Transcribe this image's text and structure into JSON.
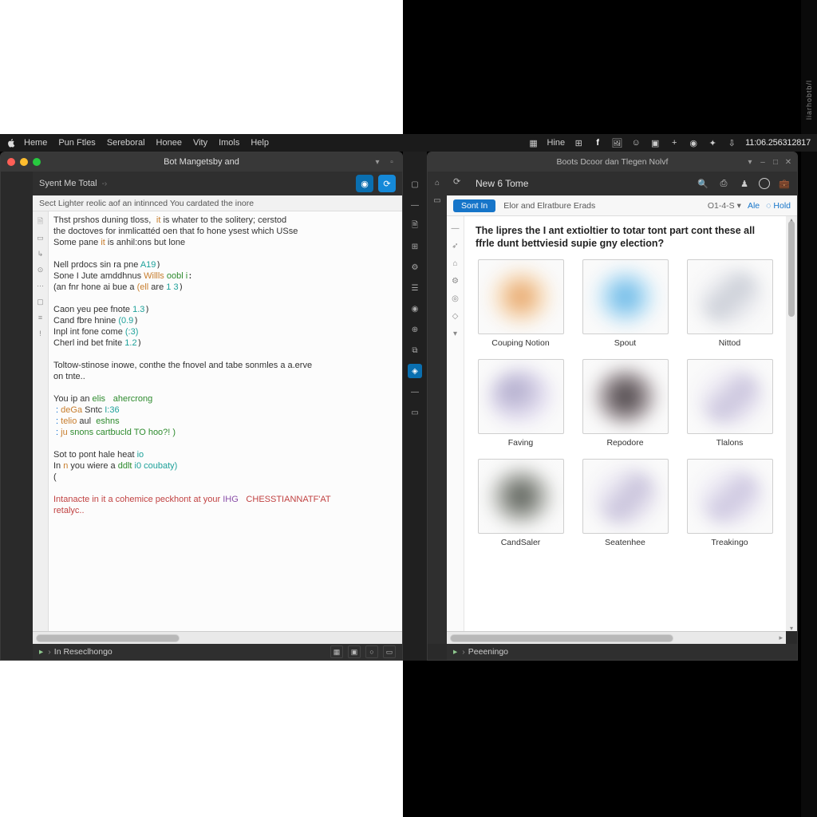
{
  "menubar": {
    "items": [
      "Heme",
      "Pun Ftles",
      "Sereboral",
      "Honee",
      "Vity",
      "Imols",
      "Help"
    ],
    "sys": [
      "Hine"
    ],
    "clock": "11:06.256312817"
  },
  "leftWin": {
    "title": "Bot Mangetsby and",
    "crumb": "Syent Me Total",
    "subbar": "Sect Lighter reolic aof an intinnced You cardated the inore",
    "editor": {
      "l1a": "Thst prshos duning tloss,",
      "l1b": "it",
      "l1c": " is whater to the solitery; cerstod",
      "l2": "the doctoves for inmlicattéd oen that fo hone ysest which USse",
      "l3a": "Some pane ",
      "l3b": "it",
      "l3c": " is anhil:ons but lone",
      "l4a": "Nell prdocs sin ra pne ",
      "l4b": "A19",
      "l5a": "Sone I Jute amddhnus ",
      "l5b": "Willls",
      "l5c": " oobl i",
      "l6a": "(an fnr hone ai bue a ",
      "l6b": "(ell",
      "l6c": " are ",
      "l6d": "1 3",
      "l7a": "Caon yeu pee fnote ",
      "l7b": "1.3",
      "l8a": "Cand fbre hnine ",
      "l8b": "(0.9",
      "l9a": "Inpl int fone come ",
      "l9b": "(:3)",
      "l10a": "Cherl ind bet fnite ",
      "l10b": "1.2",
      "l11": "Toltow-stinose inowe, conthe the fnovel and tabe sonmles a a.erve",
      "l12": "on tnte..",
      "l13a": "You ip an ",
      "l13b": "elis",
      "l13c": " ahercrong",
      "l14a": " : ",
      "l14b": "deGa",
      "l14c": " Sntc ",
      "l14d": "I:36",
      "l15a": " : ",
      "l15b": "telio",
      "l15c": " aul  ",
      "l15d": "eshns",
      "l16a": " : ",
      "l16b": "ju",
      "l16c": " snons cartbucld TO hoo?! )",
      "l17a": "Sot to pont hale heat ",
      "l17b": "io",
      "l18a": "In ",
      "l18b": "n",
      "l18c": " you wiere a ",
      "l18d": "ddlt",
      "l18e": " i0 coubaty)",
      "l19": "(",
      "l20a": "Intanacte in it a cohemice peckhont at your ",
      "l20b": "IHG",
      "l20c": " CHESSTIANNATF'AT",
      "l21": "retalyc.."
    },
    "status": "In Reseclhongo"
  },
  "rightWin": {
    "title": "Boots Dcoor dan Tlegen Nolvf",
    "crumb": "New 6 Tome",
    "chip": "Sont In",
    "secText": "Elor and Elratbure Erads",
    "dd": "O1-4-S",
    "link": "Ale",
    "hold": "Hold",
    "heading": "The lipres the I ant extioltier to totar tont part cont these all ffrle dunt bettviesid supie gny election?",
    "cards": [
      {
        "label": "Couping Notion",
        "clr": "radial-gradient(circle,#e8a66a 10%,#f5d9b8 45%,#fcf6ee 75%)"
      },
      {
        "label": "Spout",
        "clr": "radial-gradient(circle,#6ab9e8 10%,#b6ddf3 45%,#f1f8fc 75%)"
      },
      {
        "label": "Nittod",
        "clr": "linear-gradient(135deg,#f4f4f6 20%,#c9cdd6 50%,#f0f0f3 80%)"
      },
      {
        "label": "Faving",
        "clr": "radial-gradient(ellipse at 40% 40%,#b4afce 10%,#ded9ec 50%,#f6f4fa 80%)"
      },
      {
        "label": "Repodore",
        "clr": "radial-gradient(circle,#4a4447 10%,#958b8f 45%,#e9e5e7 78%)"
      },
      {
        "label": "Tlalons",
        "clr": "linear-gradient(135deg,#f2f0f6 25%,#c8c2dc 55%,#efecf5 85%)"
      },
      {
        "label": "CandSaler",
        "clr": "radial-gradient(circle,#5a5f58 10%,#a8aaa5 45%,#e9eae7 78%)"
      },
      {
        "label": "Seatenhee",
        "clr": "linear-gradient(130deg,#f0eef5 25%,#c6c0da 55%,#efecf4 85%)"
      },
      {
        "label": "Treakingo",
        "clr": "linear-gradient(135deg,#f1eff6 25%,#cbc5df 55%,#f0edf6 85%)"
      }
    ],
    "status": "Peeeningo"
  },
  "sideLabel": "liarhobtb/l"
}
